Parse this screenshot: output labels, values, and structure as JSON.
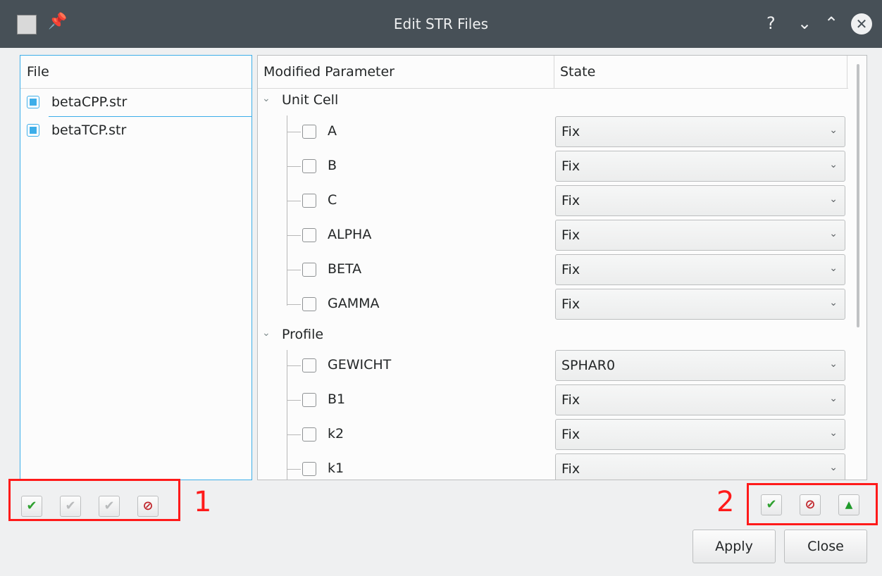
{
  "window": {
    "title": "Edit STR Files",
    "help_glyph": "?",
    "minimize_glyph": "⌄",
    "maximize_glyph": "⌃",
    "close_glyph": "✕",
    "pin_glyph": "📌"
  },
  "files": {
    "header": "File",
    "items": [
      {
        "name": "betaCPP.str",
        "checked": true
      },
      {
        "name": "betaTCP.str",
        "checked": true
      }
    ]
  },
  "params": {
    "col_param": "Modified Parameter",
    "col_state": "State",
    "groups": [
      {
        "label": "Unit Cell",
        "rows": [
          {
            "name": "A",
            "state": "Fix"
          },
          {
            "name": "B",
            "state": "Fix"
          },
          {
            "name": "C",
            "state": "Fix"
          },
          {
            "name": "ALPHA",
            "state": "Fix"
          },
          {
            "name": "BETA",
            "state": "Fix"
          },
          {
            "name": "GAMMA",
            "state": "Fix"
          }
        ]
      },
      {
        "label": "Profile",
        "rows": [
          {
            "name": "GEWICHT",
            "state": "SPHAR0"
          },
          {
            "name": "B1",
            "state": "Fix"
          },
          {
            "name": "k2",
            "state": "Fix"
          },
          {
            "name": "k1",
            "state": "Fix"
          }
        ]
      }
    ]
  },
  "annotations": {
    "left": "1",
    "right": "2"
  },
  "buttons": {
    "apply": "Apply",
    "close": "Close"
  },
  "glyphs": {
    "check": "✔",
    "check_all": "✔",
    "check_multi": "✔",
    "stop": "⊘",
    "up": "▲",
    "chevron": "⌄",
    "expanded": "⌄"
  },
  "colors": {
    "titlebar": "#475057",
    "accent": "#3daee9",
    "annotation": "#ff1a1a",
    "ok": "#2fa130",
    "stop": "#c0262c"
  }
}
